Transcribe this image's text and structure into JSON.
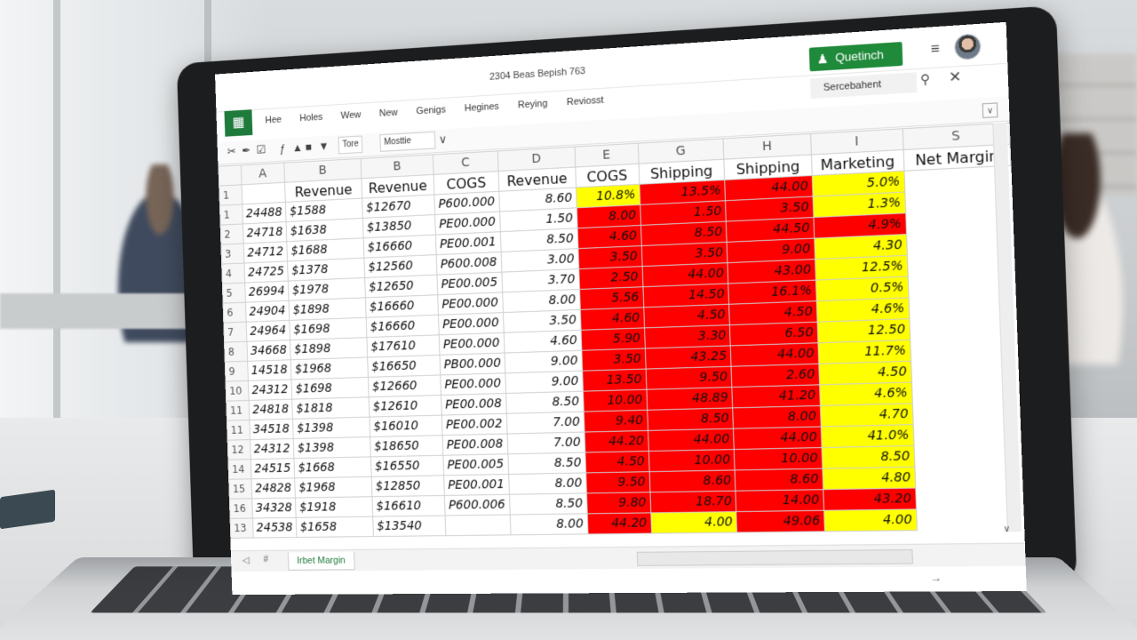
{
  "window": {
    "doc_title": "2304 Beas Bepish 763",
    "share_label": "Quetinch",
    "search_label": "Sercebahent",
    "ribbon_tabs": [
      "Hee",
      "Holes",
      "Wew",
      "New",
      "Genigs",
      "Hegines",
      "Reying",
      "Reviosst"
    ]
  },
  "toolbar": {
    "font_size_box": "Tore",
    "style_box": "Mosttie",
    "dropdown_glyph": "∨"
  },
  "columns": [
    "A",
    "B",
    "B",
    "C",
    "D",
    "E",
    "G",
    "H",
    "I",
    "S"
  ],
  "header_row": {
    "rownum": "1",
    "cells": [
      "Revenue",
      "Revenue",
      "COGS",
      "Revenue",
      "COGS",
      "Shipping",
      "Shipping",
      "Marketing",
      "Net Margin"
    ]
  },
  "rows": [
    {
      "n": "1",
      "a": "24488",
      "b": "$1588",
      "c": "$12670",
      "d": "P600.000",
      "e": "8.60",
      "g": "10.8%",
      "h": "13.5%",
      "i": "44.00",
      "s": "5.0%"
    },
    {
      "n": "2",
      "a": "24718",
      "b": "$1638",
      "c": "$13850",
      "d": "PE00.000",
      "e": "1.50",
      "g": "8.00",
      "h": "1.50",
      "i": "3.50",
      "s": "1.3%"
    },
    {
      "n": "3",
      "a": "24712",
      "b": "$1688",
      "c": "$16660",
      "d": "PE00.001",
      "e": "8.50",
      "g": "4.60",
      "h": "8.50",
      "i": "44.50",
      "s": "4.9%"
    },
    {
      "n": "4",
      "a": "24725",
      "b": "$1378",
      "c": "$12560",
      "d": "P600.008",
      "e": "3.00",
      "g": "3.50",
      "h": "3.50",
      "i": "9.00",
      "s": "4.30"
    },
    {
      "n": "5",
      "a": "26994",
      "b": "$1978",
      "c": "$12650",
      "d": "PE00.005",
      "e": "3.70",
      "g": "2.50",
      "h": "44.00",
      "i": "43.00",
      "s": "12.5%"
    },
    {
      "n": "6",
      "a": "24904",
      "b": "$1898",
      "c": "$16660",
      "d": "PE00.000",
      "e": "8.00",
      "g": "5.56",
      "h": "14.50",
      "i": "16.1%",
      "s": "0.5%"
    },
    {
      "n": "7",
      "a": "24964",
      "b": "$1698",
      "c": "$16660",
      "d": "PE00.000",
      "e": "3.50",
      "g": "4.60",
      "h": "4.50",
      "i": "4.50",
      "s": "4.6%"
    },
    {
      "n": "8",
      "a": "34668",
      "b": "$1898",
      "c": "$17610",
      "d": "PE00.000",
      "e": "4.60",
      "g": "5.90",
      "h": "3.30",
      "i": "6.50",
      "s": "12.50"
    },
    {
      "n": "9",
      "a": "14518",
      "b": "$1968",
      "c": "$16650",
      "d": "PB00.000",
      "e": "9.00",
      "g": "3.50",
      "h": "43.25",
      "i": "44.00",
      "s": "11.7%"
    },
    {
      "n": "10",
      "a": "24312",
      "b": "$1698",
      "c": "$12660",
      "d": "PE00.000",
      "e": "9.00",
      "g": "13.50",
      "h": "9.50",
      "i": "2.60",
      "s": "4.50"
    },
    {
      "n": "11",
      "a": "24818",
      "b": "$1818",
      "c": "$12610",
      "d": "PE00.008",
      "e": "8.50",
      "g": "10.00",
      "h": "48.89",
      "i": "41.20",
      "s": "4.6%"
    },
    {
      "n": "11",
      "a": "34518",
      "b": "$1398",
      "c": "$16010",
      "d": "PE00.002",
      "e": "7.00",
      "g": "9.40",
      "h": "8.50",
      "i": "8.00",
      "s": "4.70"
    },
    {
      "n": "12",
      "a": "24312",
      "b": "$1398",
      "c": "$18650",
      "d": "PE00.008",
      "e": "7.00",
      "g": "44.20",
      "h": "44.00",
      "i": "44.00",
      "s": "41.0%"
    },
    {
      "n": "14",
      "a": "24515",
      "b": "$1668",
      "c": "$16550",
      "d": "PE00.005",
      "e": "8.50",
      "g": "4.50",
      "h": "10.00",
      "i": "10.00",
      "s": "8.50"
    },
    {
      "n": "15",
      "a": "24828",
      "b": "$1968",
      "c": "$12850",
      "d": "PE00.001",
      "e": "8.00",
      "g": "9.50",
      "h": "8.60",
      "i": "8.60",
      "s": "4.80"
    },
    {
      "n": "16",
      "a": "34328",
      "b": "$1918",
      "c": "$16610",
      "d": "P600.006",
      "e": "8.50",
      "g": "9.80",
      "h": "18.70",
      "i": "14.00",
      "s": "43.20"
    },
    {
      "n": "13",
      "a": "24538",
      "b": "$1658",
      "c": "$13540",
      "d": "",
      "e": "8.00",
      "g": "44.20",
      "h": "4.00",
      "i": "49.06",
      "s": "4.00"
    }
  ],
  "highlight": {
    "g": [
      "yellow",
      "red",
      "red",
      "red",
      "red",
      "red",
      "red",
      "red",
      "red",
      "red",
      "red",
      "red",
      "red",
      "red",
      "red",
      "red",
      "red"
    ],
    "h": [
      "red",
      "red",
      "red",
      "red",
      "red",
      "red",
      "red",
      "red",
      "red",
      "red",
      "red",
      "red",
      "red",
      "red",
      "red",
      "red",
      "yellow"
    ],
    "i": [
      "red",
      "red",
      "red",
      "red",
      "red",
      "red",
      "red",
      "red",
      "red",
      "red",
      "red",
      "red",
      "red",
      "red",
      "red",
      "red",
      "red"
    ],
    "s": [
      "yellow",
      "yellow",
      "red",
      "yellow",
      "yellow",
      "yellow",
      "yellow",
      "yellow",
      "yellow",
      "yellow",
      "yellow",
      "yellow",
      "yellow",
      "yellow",
      "yellow",
      "red",
      "yellow"
    ],
    "colors": {
      "red": "#ff0000",
      "yellow": "#ffff00"
    }
  },
  "sheet": {
    "tab_label": "Irbet Margin",
    "nav_prev": "◁",
    "nav_next": "#"
  },
  "theme": {
    "accent": "#1f8a3a",
    "excel_green": "#1e7b3c"
  }
}
